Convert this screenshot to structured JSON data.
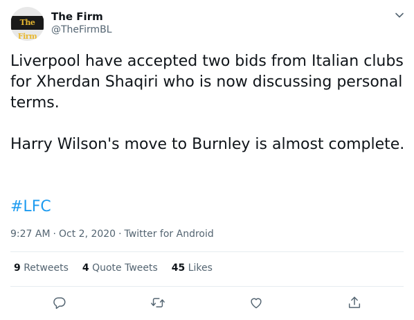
{
  "author": {
    "display_name": "The Firm",
    "handle": "@TheFirmBL",
    "avatar_text": "The Firm"
  },
  "tweet": {
    "text": "Liverpool have accepted two bids from Italian clubs for Xherdan Shaqiri who is now discussing personal terms.\n\nHarry Wilson's move to Burnley is almost complete.",
    "hashtag": "#LFC"
  },
  "meta": {
    "time": "9:27 AM",
    "date": "Oct 2, 2020",
    "source": "Twitter for Android",
    "separator": "·"
  },
  "stats": {
    "retweets": {
      "count": "9",
      "label": "Retweets"
    },
    "quote_tweets": {
      "count": "4",
      "label": "Quote Tweets"
    },
    "likes": {
      "count": "45",
      "label": "Likes"
    }
  },
  "colors": {
    "link": "#1d9bf0",
    "secondary_text": "#536471",
    "primary_text": "#0f1419",
    "divider": "#e6ecf0",
    "icon": "#536471"
  },
  "icons": {
    "more": "chevron-down-icon",
    "reply": "reply-icon",
    "retweet": "retweet-icon",
    "like": "heart-icon",
    "share": "share-icon"
  }
}
